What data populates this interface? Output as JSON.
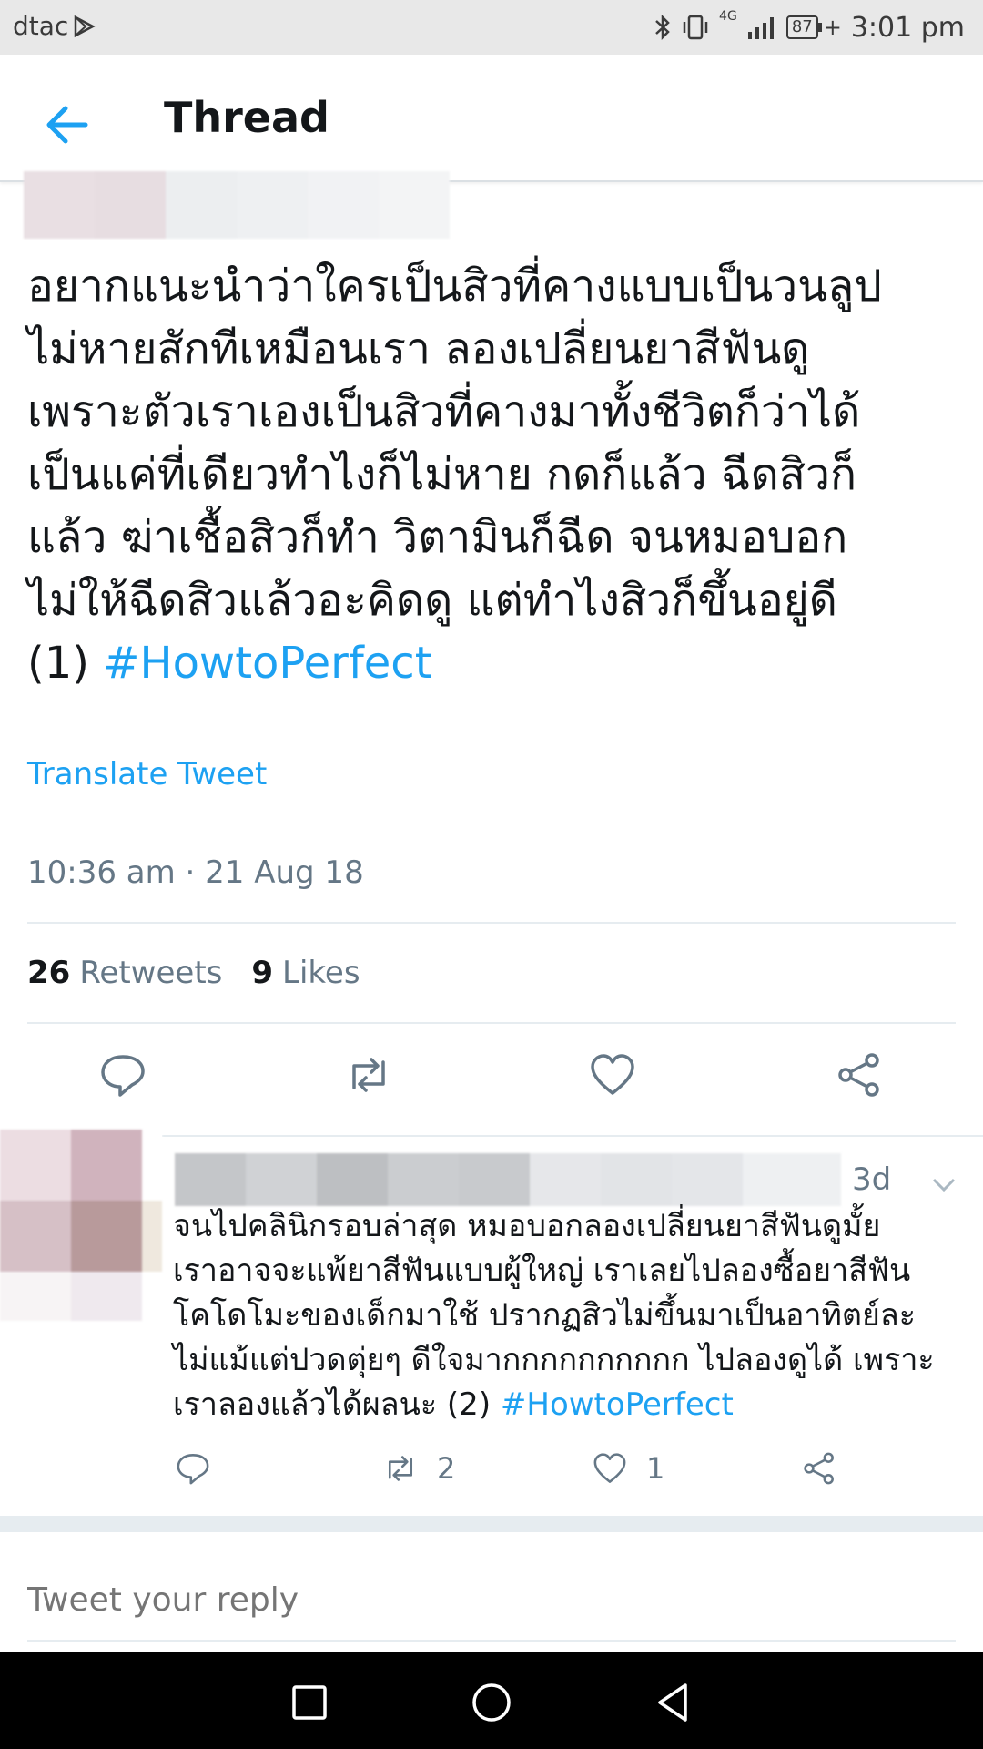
{
  "status_bar": {
    "carrier": "dtac",
    "network": "4G",
    "battery": "87",
    "time": "3:01 pm"
  },
  "header": {
    "title": "Thread",
    "back_icon": "arrow-left-icon"
  },
  "tweet": {
    "text": "อยากแนะนำว่าใครเป็นสิวที่คางแบบเป็นวนลูป\nไม่หายสักทีเหมือนเรา ลองเปลี่ยนยาสีฟันดู\nเพราะตัวเราเองเป็นสิวที่คางมาทั้งชีวิตก็ว่าได้\nเป็นแค่ที่เดียวทำไงก็ไม่หาย กดก็แล้ว ฉีดสิวก็\nแล้ว ฆ่าเชื้อสิวก็ทำ  วิตามินก็ฉีด จนหมอบอก\nไม่ให้ฉีดสิวแล้วอะคิดดู แต่ทำไงสิวก็ขึ้นอยู่ดี\n(1) ",
    "hashtag": "#HowtoPerfect",
    "translate_label": "Translate Tweet",
    "timestamp": "10:36 am · 21 Aug 18",
    "retweets_count": "26",
    "retweets_label": "Retweets",
    "likes_count": "9",
    "likes_label": "Likes"
  },
  "reply": {
    "age": "3d",
    "text": "จนไปคลินิกรอบล่าสุด หมอบอกลองเปลี่ยนยาสีฟันดูมั้ย\nเราอาจจะแพ้ยาสีฟันแบบผู้ใหญ่ เราเลยไปลองซื้อยาสีฟัน\nโคโดโมะของเด็กมาใช้ ปรากฏสิวไม่ขึ้นมาเป็นอาทิตย์ละ\nไม่แม้แต่ปวดตุ่ยๆ ดีใจมากกกกกกกกกก ไปลองดูได้ เพราะ\nเราลองแล้วได้ผลนะ (2) ",
    "hashtag": "#HowtoPerfect",
    "retweets": "2",
    "likes": "1"
  },
  "compose": {
    "placeholder": "Tweet your reply"
  },
  "colors": {
    "accent": "#1da1f2",
    "secondary_text": "#657786",
    "primary_text": "#14171a"
  }
}
